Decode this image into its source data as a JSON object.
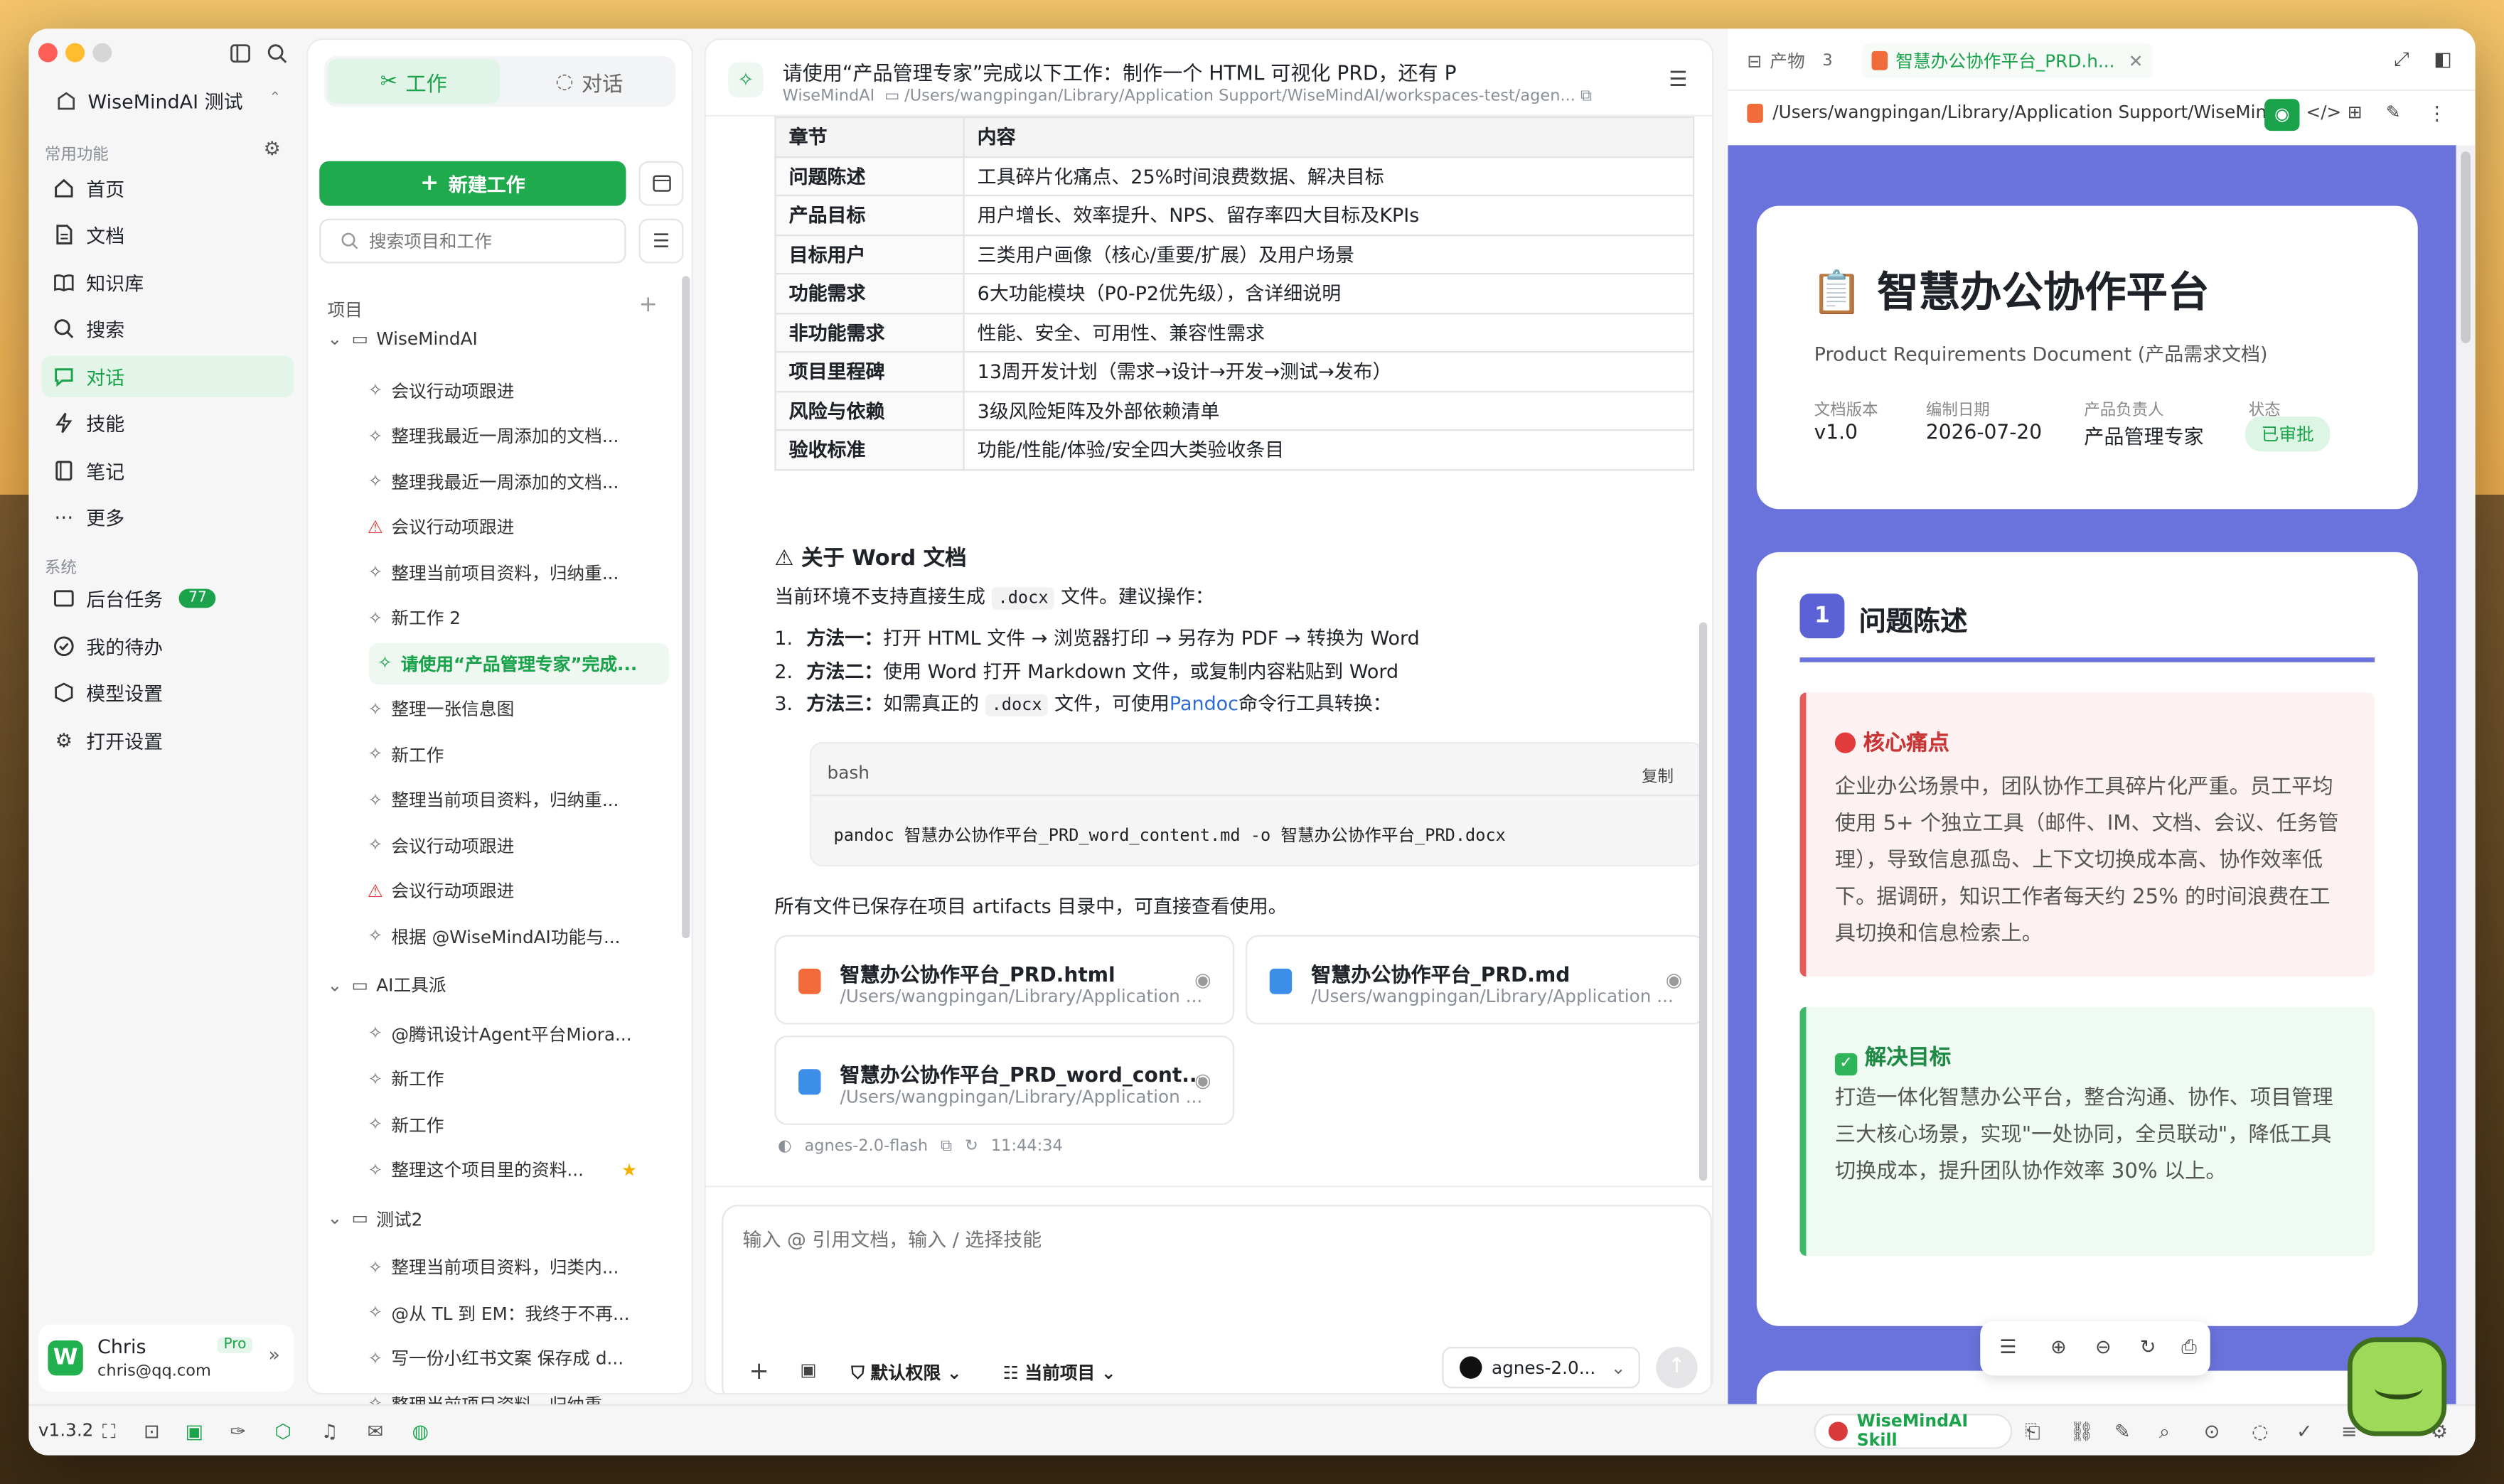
{
  "sidebar": {
    "workspace": "WiseMindAI 测试",
    "common_header": "常用功能",
    "nav": [
      "首页",
      "文档",
      "知识库",
      "搜索",
      "对话",
      "技能",
      "笔记",
      "更多"
    ],
    "system_header": "系统",
    "system": [
      "后台任务",
      "我的待办",
      "模型设置",
      "打开设置"
    ],
    "tasks_badge": "77",
    "user": {
      "name": "Chris",
      "email": "chris@qq.com",
      "plan": "Pro"
    }
  },
  "tree": {
    "tab_work": "工作",
    "tab_chat": "对话",
    "new_button": "新建工作",
    "search_placeholder": "搜索项目和工作",
    "projects_header": "项目",
    "groups": [
      {
        "name": "WiseMindAI",
        "items": [
          "会议行动项跟进",
          "整理我最近一周添加的文档...",
          "整理我最近一周添加的文档...",
          "会议行动项跟进",
          "整理当前项目资料，归纳重...",
          "新工作 2",
          "请使用“产品管理专家”完成...",
          "整理一张信息图",
          "新工作",
          "整理当前项目资料，归纳重...",
          "会议行动项跟进",
          "会议行动项跟进",
          "根据 @WiseMindAI功能与..."
        ]
      },
      {
        "name": "AI工具派",
        "items": [
          "@腾讯设计Agent平台Miora...",
          "新工作",
          "新工作",
          "整理这个项目里的资料..."
        ]
      },
      {
        "name": "测试2",
        "items": [
          "整理当前项目资料，归类内...",
          "@从 TL 到 EM：我终于不再...",
          "写一份小红书文案 保存成 d...",
          "整理当前项目资料，归纳重..."
        ]
      }
    ]
  },
  "chat": {
    "title": "请使用“产品管理专家”完成以下工作：制作一个 HTML 可视化 PRD，还有 P",
    "workspace": "WiseMindAI",
    "path": "/Users/wangpingan/Library/Application Support/WiseMindAI/workspaces-test/agen...",
    "table_header": [
      "章节",
      "内容"
    ],
    "table": [
      [
        "问题陈述",
        "工具碎片化痛点、25%时间浪费数据、解决目标"
      ],
      [
        "产品目标",
        "用户增长、效率提升、NPS、留存率四大目标及KPIs"
      ],
      [
        "目标用户",
        "三类用户画像（核心/重要/扩展）及用户场景"
      ],
      [
        "功能需求",
        "6大功能模块（P0-P2优先级），含详细说明"
      ],
      [
        "非功能需求",
        "性能、安全、可用性、兼容性需求"
      ],
      [
        "项目里程碑",
        "13周开发计划（需求→设计→开发→测试→发布）"
      ],
      [
        "风险与依赖",
        "3级风险矩阵及外部依赖清单"
      ],
      [
        "验收标准",
        "功能/性能/体验/安全四大类验收条目"
      ]
    ],
    "word_title": "关于 Word 文档",
    "intro_a": "当前环境不支持直接生成",
    "intro_code": ".docx",
    "intro_b": "文件。建议操作：",
    "steps": [
      {
        "num": "1.",
        "label": "方法一：",
        "text": "打开 HTML 文件 → 浏览器打印 → 另存为 PDF → 转换为 Word"
      },
      {
        "num": "2.",
        "label": "方法二：",
        "text": "使用 Word 打开 Markdown 文件，或复制内容粘贴到 Word"
      },
      {
        "num": "3.",
        "label": "方法三：",
        "text_a": "如需真正的",
        "code": ".docx",
        "text_b": "文件，可使用",
        "link": "Pandoc",
        "text_c": "命令行工具转换："
      }
    ],
    "code_lang": "bash",
    "copy_label": "复制",
    "code": "pandoc 智慧办公协作平台_PRD_word_content.md -o 智慧办公协作平台_PRD.docx",
    "saved_note": "所有文件已保存在项目 artifacts 目录中，可直接查看使用。",
    "files": [
      {
        "name": "智慧办公协作平台_PRD.html",
        "path": "/Users/wangpingan/Library/Application ..."
      },
      {
        "name": "智慧办公协作平台_PRD.md",
        "path": "/Users/wangpingan/Library/Application ..."
      },
      {
        "name": "智慧办公协作平台_PRD_word_cont...",
        "path": "/Users/wangpingan/Library/Application ..."
      }
    ],
    "model": "agnes-2.0-flash",
    "time": "11:44:34",
    "input_placeholder": "输入 @ 引用文档，输入 / 选择技能",
    "perm": "默认权限",
    "project": "当前项目",
    "model_select": "agnes-2.0..."
  },
  "preview": {
    "tab_artifacts": "产物",
    "artifacts_count": "3",
    "tab_file": "智慧办公协作平台_PRD.h...",
    "path": "/Users/wangpingan/Library/Application Support/WiseMind...",
    "title": "📋 智慧办公协作平台",
    "subtitle": "Product Requirements Document (产品需求文档)",
    "meta": [
      {
        "k": "文档版本",
        "v": "v1.0"
      },
      {
        "k": "编制日期",
        "v": "2026-07-20"
      },
      {
        "k": "产品负责人",
        "v": "产品管理专家"
      },
      {
        "k": "状态",
        "v": "已审批"
      }
    ],
    "sec_num": "1",
    "sec_title": "问题陈述",
    "pain_title": "核心痛点",
    "pain_text": "企业办公场景中，团队协作工具碎片化严重。员工平均使用 5+ 个独立工具（邮件、IM、文档、会议、任务管理），导致信息孤岛、上下文切换成本高、协作效率低下。据调研，知识工作者每天约 25% 的时间浪费在工具切换和信息检索上。",
    "goal_title": "解决目标",
    "goal_text": "打造一体化智慧办公平台，整合沟通、协作、项目管理三大核心场景，实现\"一处协同，全员联动\"，降低工具切换成本，提升团队协作效率 30% 以上。"
  },
  "bottom": {
    "version": "v1.3.2",
    "skill": "WiseMindAI Skill"
  },
  "colors": {
    "accent": "#1aa34a",
    "preview_bg": "#6a73dc",
    "pain_border": "#e25c5c",
    "goal_border": "#3fb86a"
  }
}
